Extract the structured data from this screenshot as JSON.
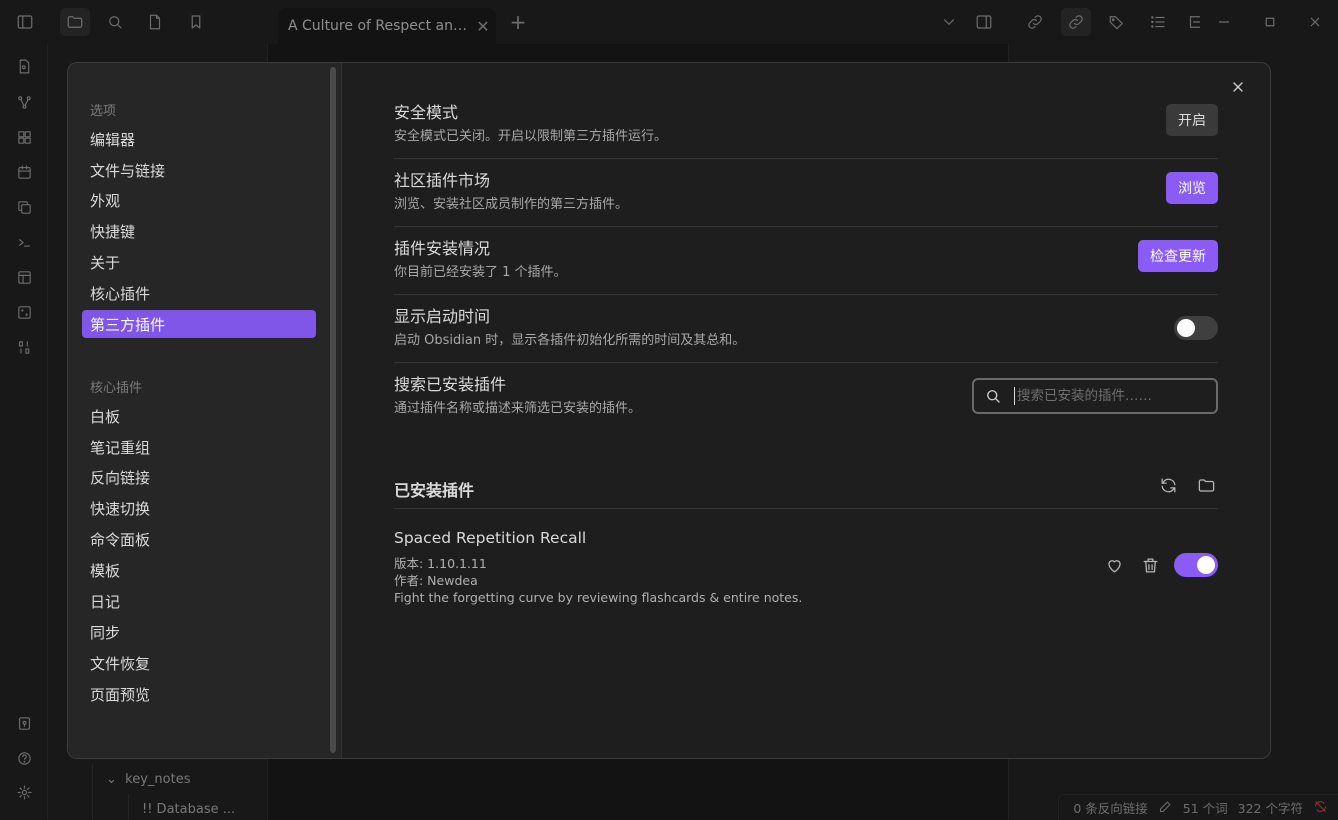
{
  "tab": {
    "title": "A Culture of Respect and ...",
    "close": "✕",
    "new": "+"
  },
  "explorer": {
    "folder": "key_notes",
    "file": "!! Database ..."
  },
  "statusbar": {
    "backlinks": "0 条反向链接",
    "words": "51 个词",
    "chars": "322 个字符"
  },
  "modal": {
    "nav": {
      "options_title": "选项",
      "options": [
        "编辑器",
        "文件与链接",
        "外观",
        "快捷键",
        "关于",
        "核心插件",
        "第三方插件"
      ],
      "core_title": "核心插件",
      "core": [
        "白板",
        "笔记重组",
        "反向链接",
        "快速切换",
        "命令面板",
        "模板",
        "日记",
        "同步",
        "文件恢复",
        "页面预览"
      ]
    },
    "settings": {
      "safe_mode": {
        "name": "安全模式",
        "desc": "安全模式已关闭。开启以限制第三方插件运行。",
        "button": "开启"
      },
      "community": {
        "name": "社区插件市场",
        "desc": "浏览、安装社区成员制作的第三方插件。",
        "button": "浏览"
      },
      "install_status": {
        "name": "插件安装情况",
        "desc": "你目前已经安装了 1 个插件。",
        "button": "检查更新"
      },
      "startup_time": {
        "name": "显示启动时间",
        "desc": "启动 Obsidian 时，显示各插件初始化所需的时间及其总和。",
        "enabled": false
      },
      "search": {
        "name": "搜索已安装插件",
        "desc": "通过插件名称或描述来筛选已安装的插件。",
        "placeholder": "搜索已安装的插件……"
      }
    },
    "installed": {
      "title": "已安装插件",
      "plugins": [
        {
          "name": "Spaced Repetition Recall",
          "version": "版本: 1.10.1.11",
          "author": "作者:  Newdea",
          "description": "Fight the forgetting curve by reviewing flashcards & entire notes.",
          "enabled": true
        }
      ]
    }
  },
  "colors": {
    "accent": "#8a5cf5",
    "selected_nav": "#7f56e8",
    "background": "#1e1e1e",
    "sidebar": "#262626"
  }
}
